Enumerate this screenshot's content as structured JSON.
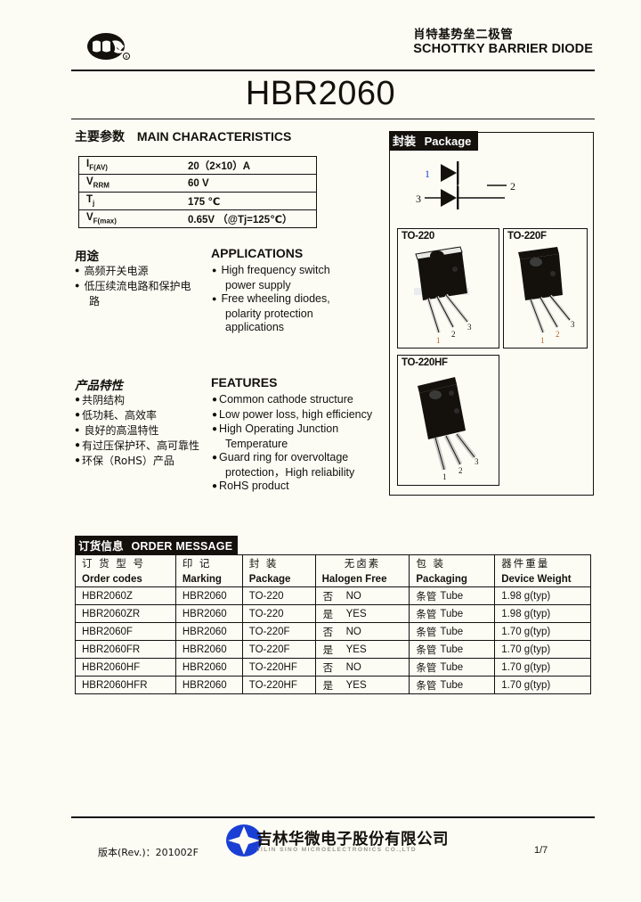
{
  "header": {
    "logo_name": "jilin-sino-logo",
    "product_cn": "肖特基势垒二极管",
    "product_en": "SCHOTTKY BARRIER DIODE",
    "part_number": "HBR2060"
  },
  "characteristics": {
    "heading_cn": "主要参数",
    "heading_en": "MAIN   CHARACTERISTICS",
    "rows": [
      {
        "symbol": "I",
        "sub": "F(AV)",
        "value": "20（2×10）A"
      },
      {
        "symbol": "V",
        "sub": "RRM",
        "value": "60 V"
      },
      {
        "symbol": "T",
        "sub": "j",
        "value": "175 ℃"
      },
      {
        "symbol": "V",
        "sub": "F(max)",
        "value": "0.65V  （@Tj=125℃）"
      }
    ]
  },
  "applications": {
    "heading_cn": "用途",
    "heading_en": "APPLICATIONS",
    "items_cn": [
      "高频开关电源",
      "低压续流电路和保护电",
      "路"
    ],
    "items_en": [
      {
        "line1": "High frequency switch",
        "line2": "power supply"
      },
      {
        "line1": "Free wheeling diodes,",
        "line2": "polarity protection",
        "line3": "applications"
      }
    ]
  },
  "features": {
    "heading_cn": "产品特性",
    "heading_en": "FEATURES",
    "items_cn": [
      "共阴结构",
      "低功耗、高效率",
      "良好的高温特性",
      "有过压保护环、高可靠性",
      "环保（RoHS）产品"
    ],
    "items_en": [
      {
        "line1": "Common cathode structure"
      },
      {
        "line1": "Low power loss, high efficiency"
      },
      {
        "line1": "High Operating Junction",
        "line2": "Temperature"
      },
      {
        "line1": "Guard ring for overvoltage",
        "line2": "protection，High reliability"
      },
      {
        "line1": "RoHS product"
      }
    ]
  },
  "package": {
    "caption_cn": "封装",
    "caption_en": "Package",
    "schematic_pins": [
      "1",
      "2",
      "3"
    ],
    "photos": [
      {
        "label": "TO-220",
        "pins": [
          "1",
          "2",
          "3"
        ]
      },
      {
        "label": "TO-220F",
        "pins": [
          "1",
          "2",
          "3"
        ]
      },
      {
        "label": "TO-220HF",
        "pins": [
          "1",
          "2",
          "3"
        ]
      }
    ]
  },
  "order_message": {
    "caption_cn": "订货信息",
    "caption_en": "ORDER MESSAGE",
    "headers_cn": [
      "订 货 型 号",
      "印    记",
      "封    装",
      "无卤素",
      "包    装",
      "器件重量"
    ],
    "headers_en": [
      "Order codes",
      "Marking",
      "Package",
      "Halogen Free",
      "Packaging",
      "Device Weight"
    ],
    "rows": [
      {
        "order_code": "HBR2060Z",
        "marking": "HBR2060",
        "package": "TO-220",
        "halogen_cn": "否",
        "halogen_en": "NO",
        "packaging_cn": "条管",
        "packaging_en": "Tube",
        "weight": "1.98 g(typ)"
      },
      {
        "order_code": "HBR2060ZR",
        "marking": "HBR2060",
        "package": "TO-220",
        "halogen_cn": "是",
        "halogen_en": "YES",
        "packaging_cn": "条管",
        "packaging_en": "Tube",
        "weight": "1.98 g(typ)"
      },
      {
        "order_code": "HBR2060F",
        "marking": "HBR2060",
        "package": "TO-220F",
        "halogen_cn": "否",
        "halogen_en": "NO",
        "packaging_cn": "条管",
        "packaging_en": "Tube",
        "weight": "1.70 g(typ)"
      },
      {
        "order_code": "HBR2060FR",
        "marking": "HBR2060",
        "package": "TO-220F",
        "halogen_cn": "是",
        "halogen_en": "YES",
        "packaging_cn": "条管",
        "packaging_en": "Tube",
        "weight": "1.70 g(typ)"
      },
      {
        "order_code": "HBR2060HF",
        "marking": "HBR2060",
        "package": "TO-220HF",
        "halogen_cn": "否",
        "halogen_en": "NO",
        "packaging_cn": "条管",
        "packaging_en": "Tube",
        "weight": "1.70 g(typ)"
      },
      {
        "order_code": "HBR2060HFR",
        "marking": "HBR2060",
        "package": "TO-220HF",
        "halogen_cn": "是",
        "halogen_en": "YES",
        "packaging_cn": "条管",
        "packaging_en": "Tube",
        "weight": "1.70 g(typ)"
      }
    ]
  },
  "footer": {
    "revision": "版本(Rev.)：201002F",
    "company_cn": "吉林华微电子股份有限公司",
    "company_en": "JILIN  SINO  MICROELECTRONICS  CO.,LTD",
    "page": "1/7",
    "logo_color": "#1a3fd4"
  }
}
